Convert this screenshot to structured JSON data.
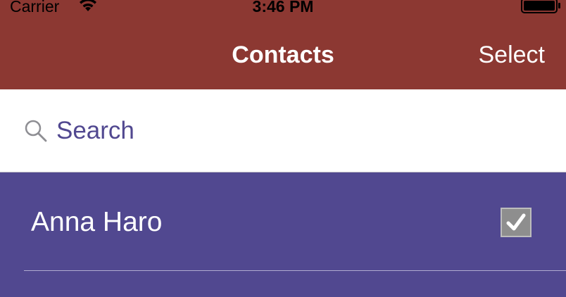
{
  "status_bar": {
    "carrier": "Carrier",
    "time": "3:46 PM",
    "wifi_icon": "wifi-icon",
    "battery_icon": "battery-icon"
  },
  "nav_bar": {
    "title": "Contacts",
    "select_label": "Select",
    "background_color": "#8c3832"
  },
  "search": {
    "placeholder": "Search",
    "value": "",
    "icon": "search-icon"
  },
  "contacts": {
    "background_color": "#514890",
    "items": [
      {
        "name": "Anna Haro",
        "checked": true
      }
    ]
  }
}
